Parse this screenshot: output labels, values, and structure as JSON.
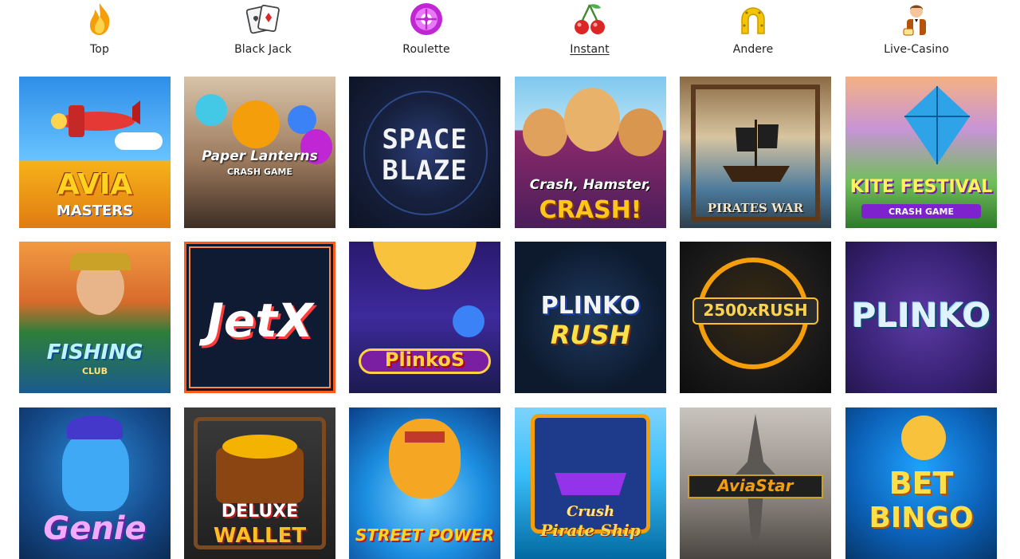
{
  "nav": {
    "items": [
      {
        "label": "Top",
        "icon": "flame-icon"
      },
      {
        "label": "Black Jack",
        "icon": "playing-cards-icon"
      },
      {
        "label": "Roulette",
        "icon": "roulette-icon"
      },
      {
        "label": "Instant",
        "icon": "cherries-icon",
        "active": true
      },
      {
        "label": "Andere",
        "icon": "horseshoe-icon"
      },
      {
        "label": "Live-Casino",
        "icon": "dealer-icon"
      }
    ]
  },
  "games": [
    {
      "title": "AVIA",
      "subtitle": "MASTERS"
    },
    {
      "title": "Paper Lanterns",
      "subtitle": "CRASH GAME"
    },
    {
      "title": "SPACE",
      "subtitle": "BLAZE"
    },
    {
      "title": "Crash, Hamster,",
      "subtitle": "CRASH!"
    },
    {
      "title": "PIRATES WAR",
      "subtitle": ""
    },
    {
      "title": "KITE FESTIVAL",
      "subtitle": "CRASH GAME"
    },
    {
      "title": "FISHING",
      "subtitle": "CLUB"
    },
    {
      "title": "JetX",
      "subtitle": ""
    },
    {
      "title": "PlinkoS",
      "subtitle": ""
    },
    {
      "title": "PLINKO",
      "subtitle": "RUSH"
    },
    {
      "title": "2500xRUSH",
      "subtitle": ""
    },
    {
      "title": "PLINKO",
      "subtitle": ""
    },
    {
      "title": "Genie",
      "subtitle": ""
    },
    {
      "title": "DELUXE",
      "subtitle": "WALLET"
    },
    {
      "title": "STREET POWER",
      "subtitle": ""
    },
    {
      "title": "Crush",
      "subtitle": "Pirate Ship"
    },
    {
      "title": "AviaStar",
      "subtitle": ""
    },
    {
      "title": "BET",
      "subtitle": "BINGO"
    }
  ]
}
